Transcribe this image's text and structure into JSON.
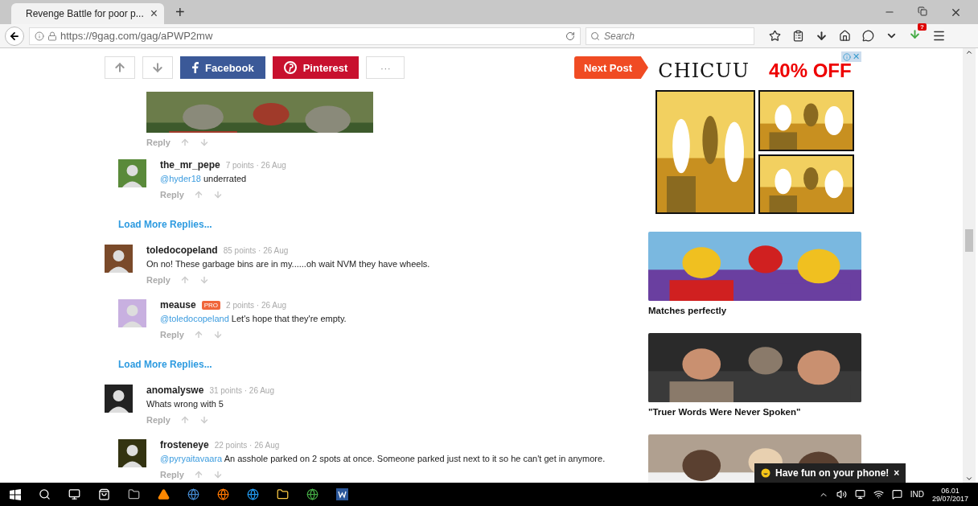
{
  "browser": {
    "tab": {
      "title": "Revenge Battle for poor p...",
      "close": "×"
    },
    "new_tab": "+",
    "url": "https://9gag.com/gag/aPWP2mw",
    "search": {
      "placeholder": "Search"
    },
    "download_badge": "?"
  },
  "share_bar": {
    "facebook": "Facebook",
    "pinterest": "Pinterest",
    "more": "···",
    "next": "Next Post"
  },
  "comments": [
    {
      "kind": "partial",
      "reply": "Reply",
      "children": [
        {
          "kind": "comment",
          "user": "the_mr_pepe",
          "meta": "7 points · 26 Aug",
          "mention": "@hyder18",
          "text": "underrated",
          "reply": "Reply"
        }
      ]
    },
    {
      "kind": "load_more",
      "label": "Load More Replies..."
    },
    {
      "kind": "comment",
      "user": "toledocopeland",
      "meta": "85 points · 26 Aug",
      "text": "On no! These garbage bins are in my......oh wait NVM they have wheels.",
      "reply": "Reply",
      "children": [
        {
          "kind": "comment",
          "user": "meause",
          "badge": "PRO",
          "meta": "2 points · 26 Aug",
          "mention": "@toledocopeland",
          "text": "Let's hope that they're empty.",
          "reply": "Reply"
        }
      ]
    },
    {
      "kind": "load_more",
      "label": "Load More Replies..."
    },
    {
      "kind": "comment",
      "user": "anomalyswe",
      "meta": "31 points · 26 Aug",
      "text": "Whats wrong with 5",
      "reply": "Reply",
      "children": [
        {
          "kind": "comment",
          "user": "frosteneye",
          "meta": "22 points · 26 Aug",
          "mention": "@pyryaitavaara",
          "text": "An asshole parked on 2 spots at once. Someone parked just next to it so he can't get in anymore.",
          "reply": "Reply"
        }
      ]
    }
  ],
  "sidebar": {
    "ad": {
      "brand": "CHICUU",
      "offer": "40% OFF"
    },
    "ad_close": "✕",
    "posts": [
      {
        "kind": "post",
        "title": "Matches perfectly"
      },
      {
        "kind": "post",
        "title": "\"Truer Words Were Never Spoken\""
      },
      {
        "kind": "picture"
      }
    ]
  },
  "toast": {
    "text": "Have fun on your phone!",
    "close": "×"
  },
  "taskbar": {
    "language": "IND",
    "time": "06.01",
    "date": "29/07/2017"
  }
}
